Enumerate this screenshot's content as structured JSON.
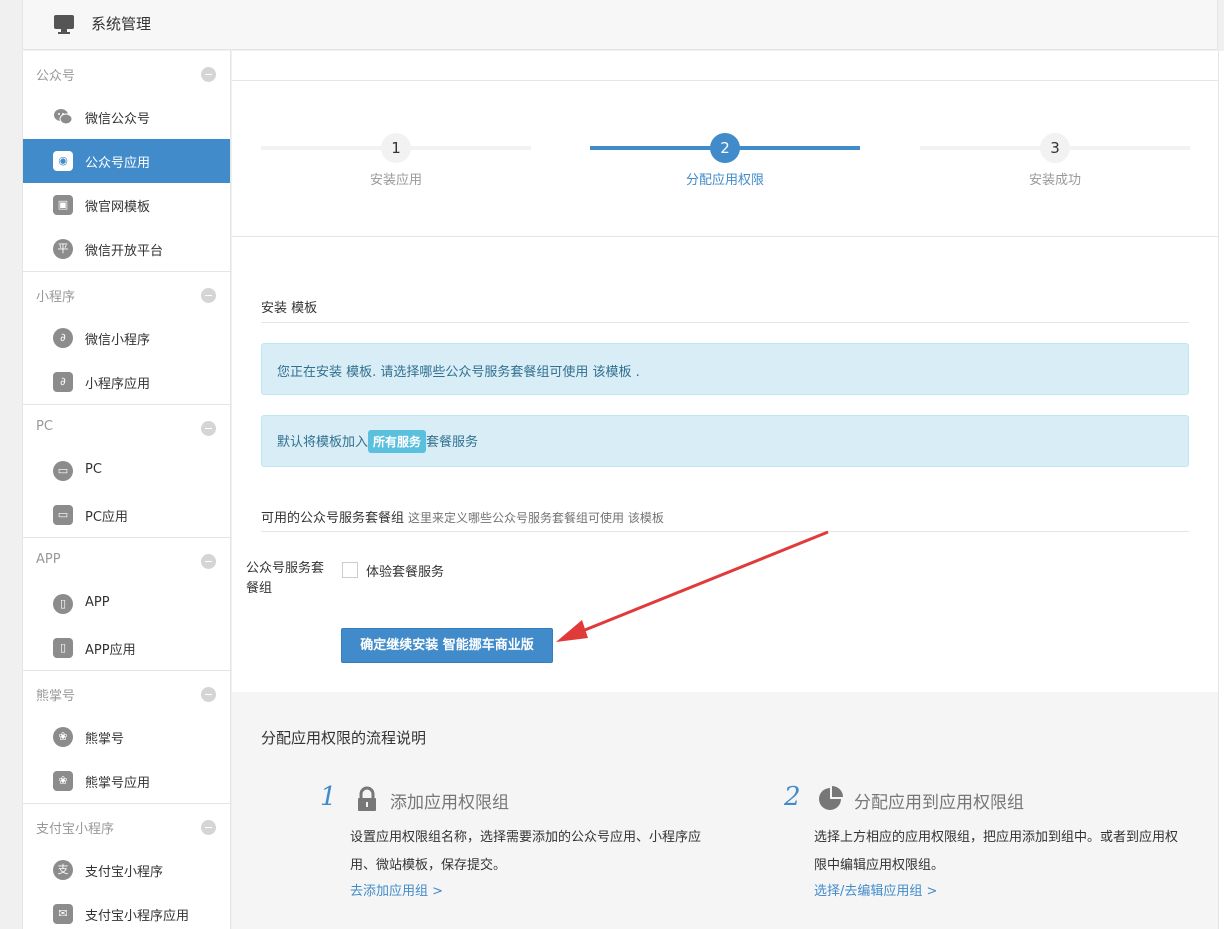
{
  "header": {
    "title": "系统管理"
  },
  "sidebar": {
    "groups": [
      {
        "label": "公众号",
        "items": [
          {
            "label": "微信公众号",
            "icon": "wechat-icon"
          },
          {
            "label": "公众号应用",
            "icon": "mp-app-icon",
            "active": true
          },
          {
            "label": "微官网模板",
            "icon": "microsite-template-icon"
          },
          {
            "label": "微信开放平台",
            "icon": "open-platform-icon",
            "glyph": "平"
          }
        ]
      },
      {
        "label": "小程序",
        "items": [
          {
            "label": "微信小程序",
            "icon": "miniprogram-icon"
          },
          {
            "label": "小程序应用",
            "icon": "miniprogram-app-icon"
          }
        ]
      },
      {
        "label": "PC",
        "items": [
          {
            "label": "PC",
            "icon": "pc-icon"
          },
          {
            "label": "PC应用",
            "icon": "pc-app-icon"
          }
        ]
      },
      {
        "label": "APP",
        "items": [
          {
            "label": "APP",
            "icon": "phone-icon"
          },
          {
            "label": "APP应用",
            "icon": "phone-app-icon"
          }
        ]
      },
      {
        "label": "熊掌号",
        "items": [
          {
            "label": "熊掌号",
            "icon": "paw-icon"
          },
          {
            "label": "熊掌号应用",
            "icon": "paw-app-icon"
          }
        ]
      },
      {
        "label": "支付宝小程序",
        "items": [
          {
            "label": "支付宝小程序",
            "icon": "alipay-icon",
            "glyph": "支"
          },
          {
            "label": "支付宝小程序应用",
            "icon": "alipay-app-icon"
          }
        ]
      }
    ]
  },
  "steps": [
    {
      "num": "1",
      "label": "安装应用"
    },
    {
      "num": "2",
      "label": "分配应用权限",
      "active": true
    },
    {
      "num": "3",
      "label": "安装成功"
    }
  ],
  "install": {
    "title": "安装 模板",
    "alert_info": "您正在安装 模板. 请选择哪些公众号服务套餐组可使用 该模板 .",
    "alert_default_prefix": "默认将模板加入",
    "alert_default_badge": "所有服务",
    "alert_default_suffix": "套餐服务",
    "available_label": "可用的公众号服务套餐组",
    "available_hint": "这里来定义哪些公众号服务套餐组可使用 该模板",
    "field_label": "公众号服务套餐组",
    "checkbox_label": "体验套餐服务",
    "confirm_button": "确定继续安装 智能挪车商业版"
  },
  "process": {
    "title": "分配应用权限的流程说明",
    "steps": [
      {
        "num": "1",
        "icon": "lock-icon",
        "title": "添加应用权限组",
        "desc": "设置应用权限组名称，选择需要添加的公众号应用、小程序应用、微站模板，保存提交。",
        "link": "去添加应用组 >"
      },
      {
        "num": "2",
        "icon": "pie-chart-icon",
        "title": "分配应用到应用权限组",
        "desc": "选择上方相应的应用权限组，把应用添加到组中。或者到应用权限中编辑应用权限组。",
        "link": "选择/去编辑应用组 >"
      }
    ]
  },
  "colors": {
    "accent": "#428bca",
    "info_bg": "#d9edf7",
    "badge": "#5bc0de",
    "arrow": "#e03a3a"
  }
}
